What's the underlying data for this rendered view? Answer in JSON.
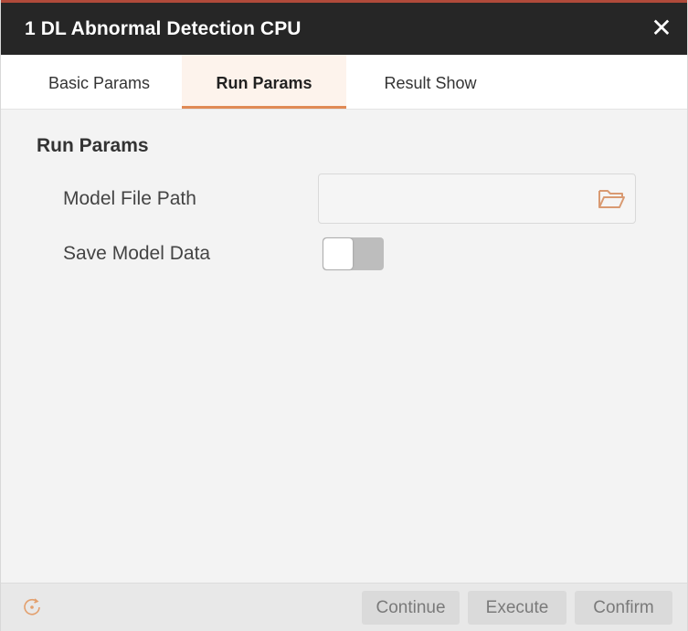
{
  "window": {
    "title": "1 DL Abnormal Detection CPU",
    "close_label": "✕"
  },
  "tabs": [
    {
      "label": "Basic Params",
      "active": false
    },
    {
      "label": "Run Params",
      "active": true
    },
    {
      "label": "Result Show",
      "active": false
    }
  ],
  "run_params": {
    "section_title": "Run Params",
    "model_file_path": {
      "label": "Model File Path",
      "value": "",
      "placeholder": ""
    },
    "save_model_data": {
      "label": "Save Model Data",
      "enabled": false
    }
  },
  "footer": {
    "buttons": {
      "continue": "Continue",
      "execute": "Execute",
      "confirm": "Confirm"
    }
  },
  "colors": {
    "titlebar": "#262626",
    "accent": "#e08a55",
    "active_tab_bg": "#fdf3ec"
  },
  "icons": [
    "close-icon",
    "folder-open-icon",
    "refresh-icon"
  ]
}
